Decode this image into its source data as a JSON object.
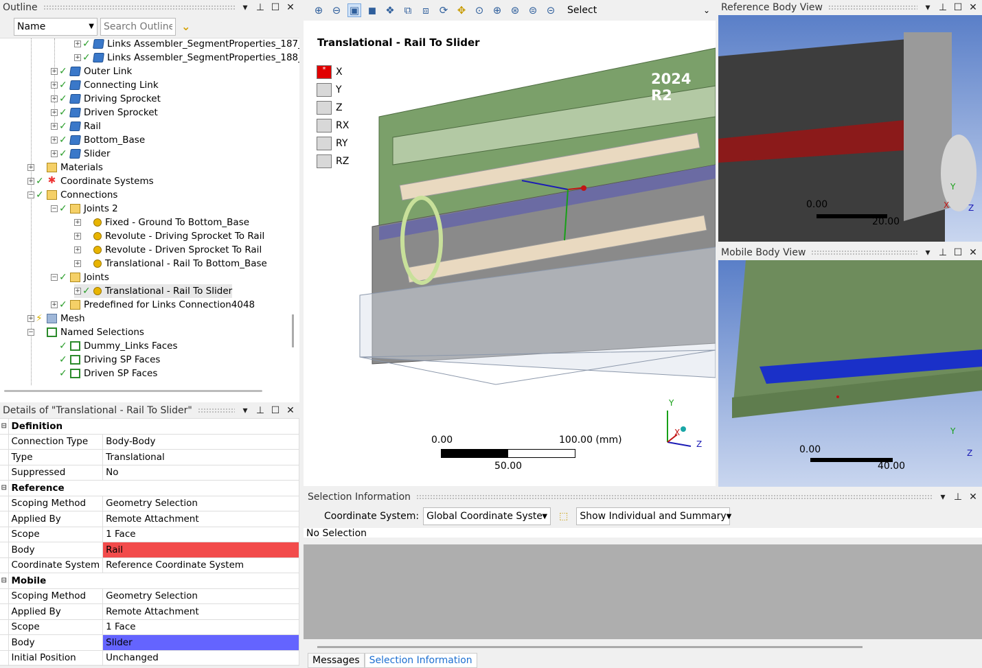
{
  "outline": {
    "title": "Outline",
    "name_dropdown": "Name",
    "search_placeholder": "Search Outline",
    "items": [
      {
        "label": "Links Assembler_SegmentProperties_187_",
        "icon": "body-icon"
      },
      {
        "label": "Links Assembler_SegmentProperties_188_",
        "icon": "body-icon"
      },
      {
        "label": "Outer Link",
        "icon": "body-icon"
      },
      {
        "label": "Connecting Link",
        "icon": "body-icon"
      },
      {
        "label": "Driving Sprocket",
        "icon": "body-icon"
      },
      {
        "label": "Driven Sprocket",
        "icon": "body-icon"
      },
      {
        "label": "Rail",
        "icon": "body-icon"
      },
      {
        "label": "Bottom_Base",
        "icon": "body-icon"
      },
      {
        "label": "Slider",
        "icon": "body-icon"
      },
      {
        "label": "Materials",
        "icon": "folder-icon"
      },
      {
        "label": "Coordinate Systems",
        "icon": "coordinate-system-icon"
      },
      {
        "label": "Connections",
        "icon": "folder-icon"
      },
      {
        "label": "Joints 2",
        "icon": "folder-icon"
      },
      {
        "label": "Fixed - Ground To Bottom_Base",
        "icon": "joint-icon"
      },
      {
        "label": "Revolute - Driving Sprocket To Rail",
        "icon": "joint-icon"
      },
      {
        "label": "Revolute - Driven Sprocket To Rail",
        "icon": "joint-icon"
      },
      {
        "label": "Translational - Rail To Bottom_Base",
        "icon": "joint-icon"
      },
      {
        "label": "Joints",
        "icon": "folder-icon"
      },
      {
        "label": "Translational - Rail To Slider",
        "icon": "joint-icon"
      },
      {
        "label": "Predefined for Links Connection4048",
        "icon": "folder-icon"
      },
      {
        "label": "Mesh",
        "icon": "mesh-icon"
      },
      {
        "label": "Named Selections",
        "icon": "named-selection-icon"
      },
      {
        "label": "Dummy_Links Faces",
        "icon": "named-selection-icon"
      },
      {
        "label": "Driving SP Faces",
        "icon": "named-selection-icon"
      },
      {
        "label": "Driven SP Faces",
        "icon": "named-selection-icon"
      }
    ]
  },
  "details": {
    "title": "Details of \"Translational - Rail To Slider\"",
    "rows": [
      {
        "type": "category",
        "label": "Definition"
      },
      {
        "type": "prop",
        "label": "Connection Type",
        "value": "Body-Body"
      },
      {
        "type": "prop",
        "label": "Type",
        "value": "Translational"
      },
      {
        "type": "prop",
        "label": "Suppressed",
        "value": "No"
      },
      {
        "type": "category",
        "label": "Reference"
      },
      {
        "type": "prop",
        "label": "Scoping Method",
        "value": "Geometry Selection"
      },
      {
        "type": "prop",
        "label": "Applied By",
        "value": "Remote Attachment"
      },
      {
        "type": "prop",
        "label": "Scope",
        "value": "1 Face"
      },
      {
        "type": "prop",
        "label": "Body",
        "value": "Rail",
        "highlight": "#f24b4b"
      },
      {
        "type": "prop",
        "label": "Coordinate System",
        "value": "Reference Coordinate System"
      },
      {
        "type": "category",
        "label": "Mobile"
      },
      {
        "type": "prop",
        "label": "Scoping Method",
        "value": "Geometry Selection"
      },
      {
        "type": "prop",
        "label": "Applied By",
        "value": "Remote Attachment"
      },
      {
        "type": "prop",
        "label": "Scope",
        "value": "1 Face"
      },
      {
        "type": "prop",
        "label": "Body",
        "value": "Slider",
        "highlight": "#6464ff"
      },
      {
        "type": "prop",
        "label": "Initial Position",
        "value": "Unchanged"
      }
    ]
  },
  "toolbar": {
    "select_label": "Select"
  },
  "graphics": {
    "title": "Translational - Rail To Slider",
    "version": "2024 R2",
    "dofs": [
      "X",
      "Y",
      "Z",
      "RX",
      "RY",
      "RZ"
    ],
    "scale_left": "0.00",
    "scale_right": "100.00 (mm)",
    "scale_mid": "50.00",
    "axis_x": "X",
    "axis_y": "Y",
    "axis_z": "Z"
  },
  "reference_view": {
    "title": "Reference Body View",
    "scale_left": "0.00",
    "scale_right": "20.00",
    "axis_x": "X",
    "axis_y": "Y",
    "axis_z": "Z"
  },
  "mobile_view": {
    "title": "Mobile Body View",
    "scale_left": "0.00",
    "scale_right": "40.00",
    "axis_y": "Y",
    "axis_z": "Z"
  },
  "selection": {
    "title": "Selection Information",
    "coord_label": "Coordinate System:",
    "coord_value": "Global Coordinate System",
    "mode_value": "Show Individual and Summary",
    "status": "No Selection",
    "tabs": [
      "Messages",
      "Selection Information"
    ]
  }
}
